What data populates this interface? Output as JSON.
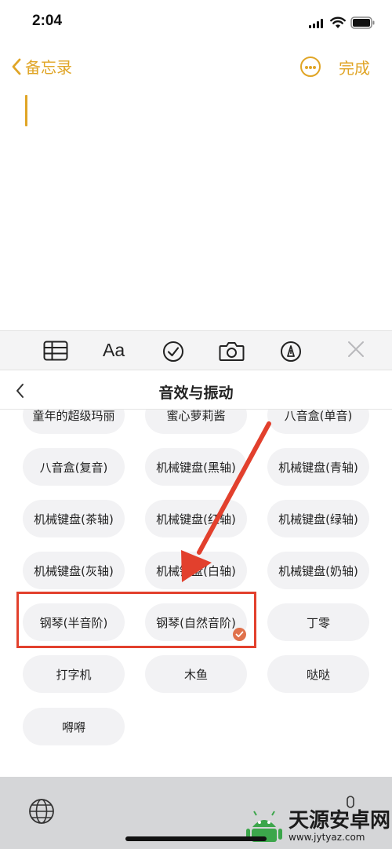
{
  "status": {
    "time": "2:04"
  },
  "nav": {
    "back_label": "备忘录",
    "done_label": "完成"
  },
  "panel": {
    "title": "音效与振动"
  },
  "chips": [
    "童年的超级玛丽",
    "蜜心萝莉酱",
    "八音盒(单音)",
    "八音盒(复音)",
    "机械键盘(黑轴)",
    "机械键盘(青轴)",
    "机械键盘(茶轴)",
    "机械键盘(红轴)",
    "机械键盘(绿轴)",
    "机械键盘(灰轴)",
    "机械键盘(白轴)",
    "机械键盘(奶轴)",
    "钢琴(半音阶)",
    "钢琴(自然音阶)",
    "丁零",
    "打字机",
    "木鱼",
    "哒哒",
    "嘚嘚"
  ],
  "selected_chip": "钢琴(自然音阶)",
  "toolbar": {
    "text_format_label": "Aa"
  },
  "watermark": {
    "brand": "天源安卓网",
    "url": "www.jytyaz.com"
  },
  "colors": {
    "accent": "#e0a526",
    "highlight": "#e2402d",
    "check": "#e0714b"
  }
}
